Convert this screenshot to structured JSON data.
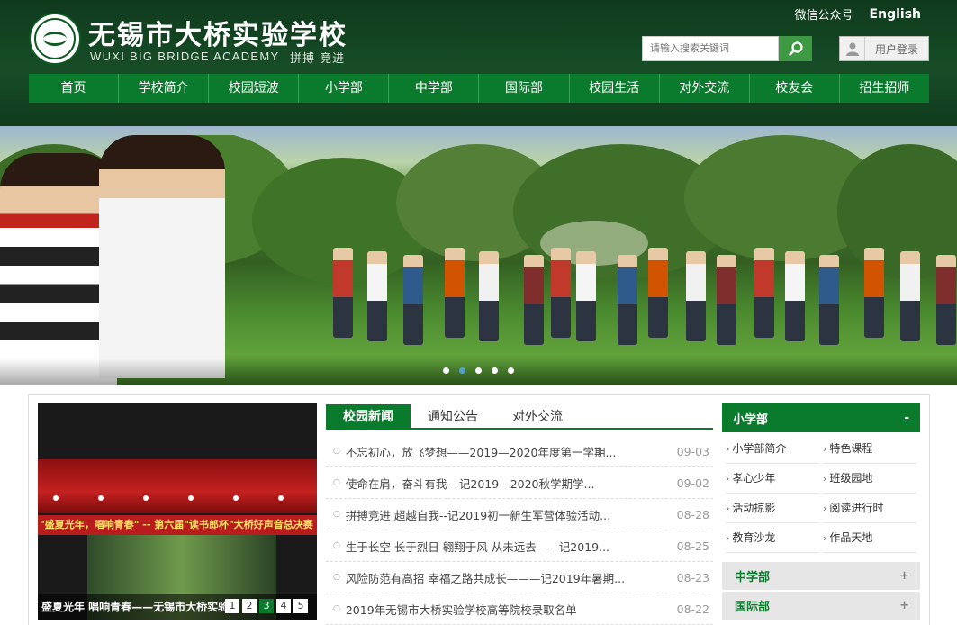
{
  "header": {
    "title": "无锡市大桥实验学校",
    "subtitle": "WUXI BIG BRIDGE ACADEMY",
    "motto": "拼搏 竞进",
    "top_links": {
      "wechat": "微信公众号",
      "english": "English"
    },
    "search_placeholder": "请输入搜索关键词",
    "login_label": "用户登录"
  },
  "nav": [
    "首页",
    "学校简介",
    "校园短波",
    "小学部",
    "中学部",
    "国际部",
    "校园生活",
    "对外交流",
    "校友会",
    "招生招师"
  ],
  "banner": {
    "dot_count": 5,
    "active_dot": 2
  },
  "photo_slider": {
    "banner_text": "\"盛夏光年，唱响青春\" -- 第六届\"读书郎杯\"大桥好声音总决赛",
    "caption": "盛夏光年 唱响青春——无锡市大桥实验",
    "pages": [
      "1",
      "2",
      "3",
      "4",
      "5"
    ],
    "active_page": "3"
  },
  "news": {
    "tabs": [
      "校园新闻",
      "通知公告",
      "对外交流"
    ],
    "active_tab": "校园新闻",
    "items": [
      {
        "title": "不忘初心，放飞梦想——2019—2020年度第一学期...",
        "date": "09-03"
      },
      {
        "title": "使命在肩，奋斗有我---记2019—2020秋学期学...",
        "date": "09-02"
      },
      {
        "title": "拼搏竞进 超越自我--记2019初一新生军营体验活动...",
        "date": "08-28"
      },
      {
        "title": "生于长空 长于烈日 翱翔于风 从未远去——记2019...",
        "date": "08-25"
      },
      {
        "title": "风险防范有高招 幸福之路共成长———记2019年暑期...",
        "date": "08-23"
      },
      {
        "title": "2019年无锡市大桥实验学校高等院校录取名单",
        "date": "08-22"
      }
    ]
  },
  "side": {
    "open_section": {
      "title": "小学部",
      "toggle": "-",
      "links": [
        "小学部简介",
        "特色课程",
        "孝心少年",
        "班级园地",
        "活动掠影",
        "阅读进行时",
        "教育沙龙",
        "作品天地"
      ]
    },
    "collapsed_sections": [
      {
        "title": "中学部",
        "toggle": "+"
      },
      {
        "title": "国际部",
        "toggle": "+"
      }
    ]
  },
  "colors": {
    "header_bg": "#174d27",
    "nav_green": "#0a7a2c",
    "search_btn": "#3e9a42",
    "active_dot": "#5aa0c8"
  },
  "icons": {
    "search": "magnifier-icon",
    "user": "user-icon",
    "bullet": "circle-bullet-icon",
    "arrow": "chevron-right-icon"
  }
}
